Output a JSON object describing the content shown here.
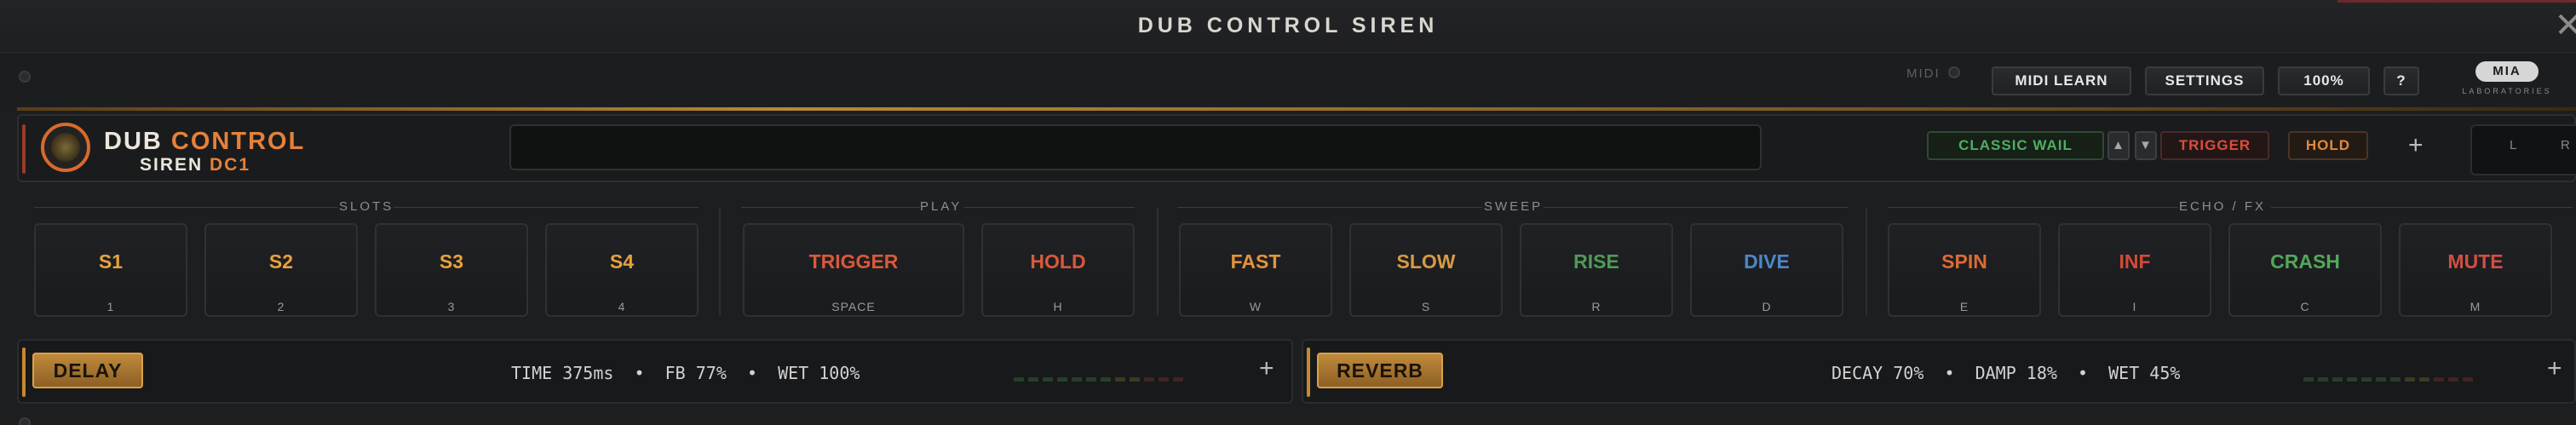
{
  "window": {
    "title": "DUB CONTROL SIREN",
    "close_glyph": "✕"
  },
  "toolbar": {
    "midi_label": "MIDI",
    "midi_learn": "MIDI LEARN",
    "settings": "SETTINGS",
    "zoom": "100%",
    "help": "?"
  },
  "logo": {
    "badge": "MIA",
    "subtitle": "LABORATORIES"
  },
  "brand": {
    "word1": "DUB",
    "word2": "CONTROL",
    "word3": "SIREN",
    "word4": "DC1"
  },
  "header": {
    "preset_name": "CLASSIC WAIL",
    "preset_up": "▲",
    "preset_down": "▼",
    "trigger": "TRIGGER",
    "hold": "HOLD",
    "add": "+",
    "meter_left": "L",
    "meter_right": "R"
  },
  "sections": {
    "slots": "SLOTS",
    "play": "PLAY",
    "sweep": "SWEEP",
    "echo_fx": "ECHO / FX"
  },
  "pads": [
    {
      "label": "S1",
      "key": "1",
      "color": "#e8a23c"
    },
    {
      "label": "S2",
      "key": "2",
      "color": "#e8a23c"
    },
    {
      "label": "S3",
      "key": "3",
      "color": "#e8a23c"
    },
    {
      "label": "S4",
      "key": "4",
      "color": "#e8a23c"
    },
    {
      "label": "TRIGGER",
      "key": "SPACE",
      "color": "#d9593a"
    },
    {
      "label": "HOLD",
      "key": "H",
      "color": "#d9593a"
    },
    {
      "label": "FAST",
      "key": "W",
      "color": "#e2933c"
    },
    {
      "label": "SLOW",
      "key": "S",
      "color": "#d79a44"
    },
    {
      "label": "RISE",
      "key": "R",
      "color": "#4f9a58"
    },
    {
      "label": "DIVE",
      "key": "D",
      "color": "#4d86c8"
    },
    {
      "label": "SPIN",
      "key": "E",
      "color": "#dd6a34"
    },
    {
      "label": "INF",
      "key": "I",
      "color": "#d24a38"
    },
    {
      "label": "CRASH",
      "key": "C",
      "color": "#52a85a"
    },
    {
      "label": "MUTE",
      "key": "M",
      "color": "#d24f42"
    }
  ],
  "delay": {
    "name": "DELAY",
    "stats": "TIME 375ms  •  FB 77%  •  WET 100%",
    "add": "+"
  },
  "reverb": {
    "name": "REVERB",
    "stats": "DECAY 70%  •  DAMP 18%  •  WET 45%",
    "add": "+"
  },
  "colors": {
    "accent_orange": "#e4823a",
    "gold": "#c7892e",
    "green": "#4fae62",
    "red": "#e04a3c"
  }
}
